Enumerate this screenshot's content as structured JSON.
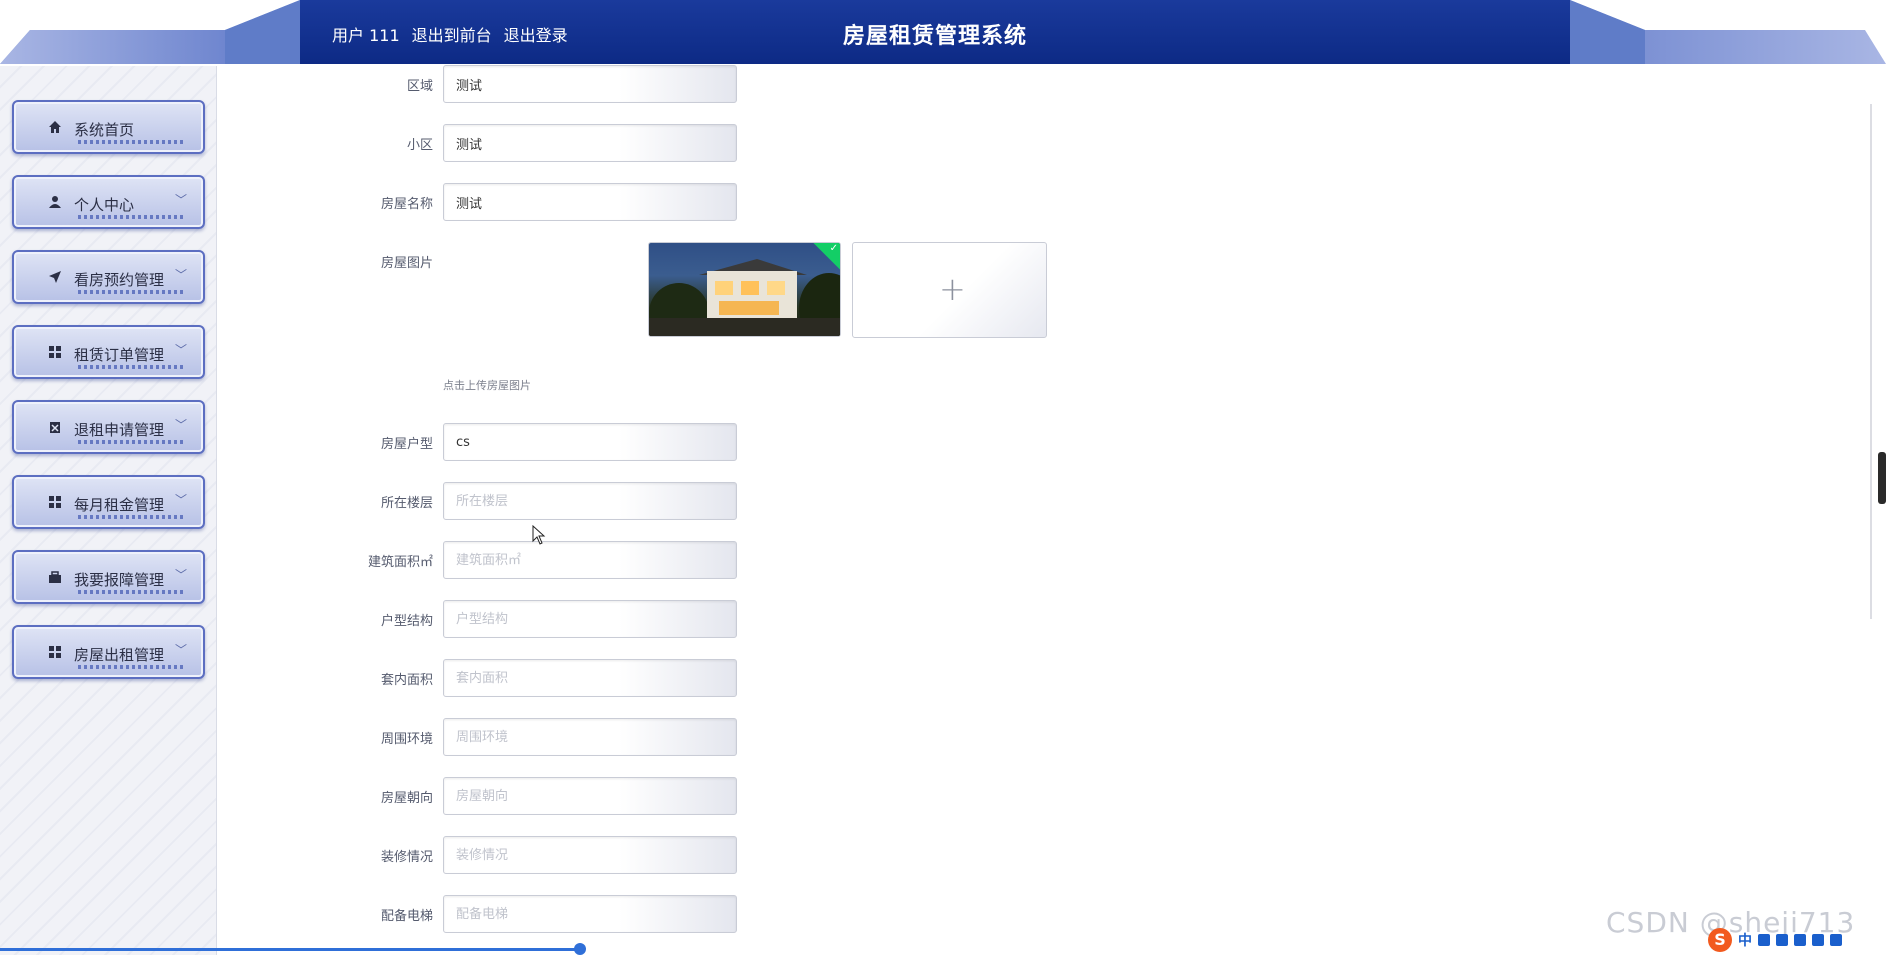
{
  "header": {
    "user_label": "用户 111",
    "front_link": "退出到前台",
    "logout_link": "退出登录",
    "title": "房屋租赁管理系统",
    "accent_color": "#0d2a85"
  },
  "sidebar": {
    "items": [
      {
        "label": "系统首页",
        "icon": "home-icon",
        "has_chevron": false
      },
      {
        "label": "个人中心",
        "icon": "user-icon",
        "has_chevron": true
      },
      {
        "label": "看房预约管理",
        "icon": "send-icon",
        "has_chevron": true
      },
      {
        "label": "租赁订单管理",
        "icon": "grid-icon",
        "has_chevron": true
      },
      {
        "label": "退租申请管理",
        "icon": "delete-box-icon",
        "has_chevron": true
      },
      {
        "label": "每月租金管理",
        "icon": "grid-icon",
        "has_chevron": true
      },
      {
        "label": "我要报障管理",
        "icon": "toolbox-icon",
        "has_chevron": true
      },
      {
        "label": "房屋出租管理",
        "icon": "grid-icon",
        "has_chevron": true
      }
    ],
    "chevron": "﹀"
  },
  "form": {
    "region": {
      "label": "区域",
      "value": "测试"
    },
    "community": {
      "label": "小区",
      "value": "测试"
    },
    "house_name": {
      "label": "房屋名称",
      "value": "测试"
    },
    "house_image": {
      "label": "房屋图片",
      "hint": "点击上传房屋图片"
    },
    "house_type": {
      "label": "房屋户型",
      "value": "cs"
    },
    "floor": {
      "label": "所在楼层",
      "placeholder": "所在楼层"
    },
    "building_area": {
      "label": "建筑面积㎡",
      "placeholder": "建筑面积㎡"
    },
    "structure": {
      "label": "户型结构",
      "placeholder": "户型结构"
    },
    "inner_area": {
      "label": "套内面积",
      "placeholder": "套内面积"
    },
    "environment": {
      "label": "周围环境",
      "placeholder": "周围环境"
    },
    "orientation": {
      "label": "房屋朝向",
      "placeholder": "房屋朝向"
    },
    "decoration": {
      "label": "装修情况",
      "placeholder": "装修情况"
    },
    "elevator": {
      "label": "配备电梯",
      "placeholder": "配备电梯"
    }
  },
  "overlay": {
    "watermark": "CSDN @sheji713",
    "ime_logo": "S",
    "ime_lang": "中"
  }
}
